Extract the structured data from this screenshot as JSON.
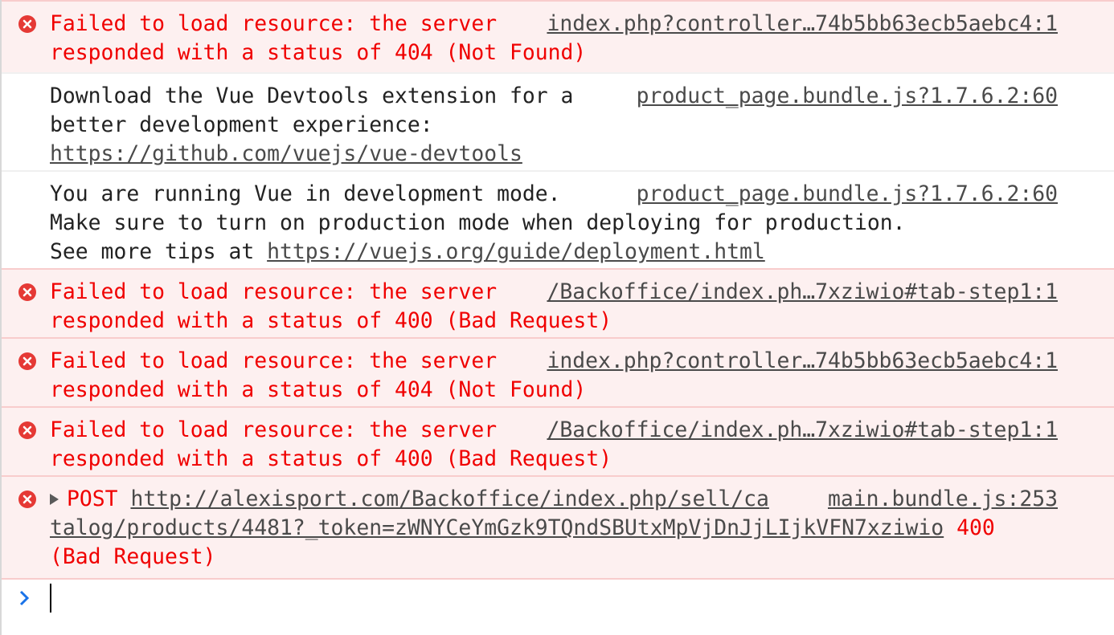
{
  "messages": [
    {
      "level": "error",
      "text_line1": "Failed to load resource: the server",
      "text_line2": "responded with a status of 404 (Not Found)",
      "source": "index.php?controller…74b5bb63ecb5aebc4:1"
    },
    {
      "level": "info",
      "text_line1": "Download the Vue Devtools extension for a",
      "text_line2": "better development experience:",
      "link": "https://github.com/vuejs/vue-devtools",
      "source": "product_page.bundle.js?1.7.6.2:60"
    },
    {
      "level": "info",
      "text_line1": "You are running Vue in development mode.",
      "text_line2": "Make sure to turn on production mode when deploying for production.",
      "text_line3_prefix": "See more tips at ",
      "link": "https://vuejs.org/guide/deployment.html",
      "source": "product_page.bundle.js?1.7.6.2:60"
    },
    {
      "level": "error",
      "text_line1": "Failed to load resource: the server",
      "text_line2": "responded with a status of 400 (Bad Request)",
      "source": "/Backoffice/index.ph…7xziwio#tab-step1:1"
    },
    {
      "level": "error",
      "text_line1": "Failed to load resource: the server",
      "text_line2": "responded with a status of 404 (Not Found)",
      "source": "index.php?controller…74b5bb63ecb5aebc4:1"
    },
    {
      "level": "error",
      "text_line1": "Failed to load resource: the server",
      "text_line2": "responded with a status of 400 (Bad Request)",
      "source": "/Backoffice/index.ph…7xziwio#tab-step1:1"
    },
    {
      "level": "error",
      "method": "POST",
      "url_line1": "http://alexisport.com/Backoffice/index.php/sell/ca",
      "url_line2": "talog/products/4481?_token=zWNYCeYmGzk9TQndSBUtxMpVjDnJjLIjkVFN7xziwio",
      "status": " 400",
      "status_text": "(Bad Request)",
      "source": "main.bundle.js:253"
    }
  ],
  "colors": {
    "error_text": "#f00000",
    "error_bg": "#fdf0f0",
    "error_border": "#f8cccc",
    "prompt_chevron": "#1a73e8"
  },
  "icons": {
    "error": "error-circle-icon",
    "expand": "expand-triangle-icon",
    "prompt": "chevron-right-icon"
  }
}
